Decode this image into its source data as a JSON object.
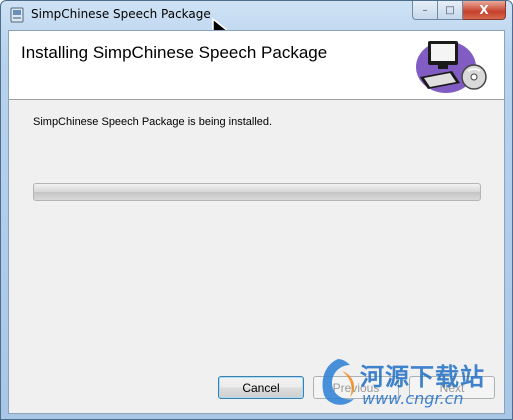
{
  "window": {
    "title": "SimpChinese Speech Package",
    "caption": {
      "minimize": "–",
      "maximize": "□",
      "close": "X"
    }
  },
  "banner": {
    "title": "Installing SimpChinese Speech Package",
    "art_icon": "computer-with-cd-icon"
  },
  "body": {
    "description": "SimpChinese Speech Package is being installed.",
    "progress_fraction": 0.0
  },
  "buttons": {
    "cancel": "Cancel",
    "previous": "Previous",
    "next": "Next"
  },
  "watermark": {
    "text": "河源下载站",
    "url": "www.cngr.cn"
  },
  "colors": {
    "accent": "#1f6fc5",
    "close_button": "#c7402c"
  }
}
